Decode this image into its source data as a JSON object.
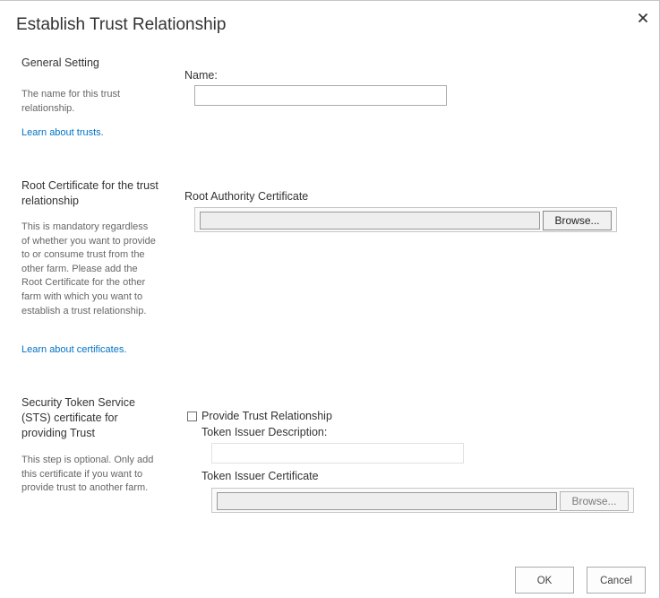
{
  "dialog": {
    "title": "Establish Trust Relationship",
    "close_icon": "close-icon"
  },
  "general": {
    "title": "General Setting",
    "description": "The name for this trust relationship.",
    "link": "Learn about trusts.",
    "name_label": "Name:",
    "name_value": ""
  },
  "root_cert": {
    "title": "Root Certificate for the trust relationship",
    "description": "This is mandatory regardless of whether you want to provide to or consume trust from the other farm. Please add the Root Certificate for the other farm with which you want to establish a trust relationship.",
    "link": "Learn about certificates.",
    "field_label": "Root Authority Certificate",
    "file_value": "",
    "browse_label": "Browse..."
  },
  "sts": {
    "title": "Security Token Service (STS) certificate for providing Trust",
    "description": "This step is optional. Only add this certificate if you want to provide trust to another farm.",
    "checkbox_label": "Provide Trust Relationship",
    "checkbox_checked": false,
    "token_desc_label": "Token Issuer Description:",
    "token_desc_value": "",
    "token_cert_label": "Token Issuer Certificate",
    "token_cert_value": "",
    "browse_label": "Browse..."
  },
  "footer": {
    "ok_label": "OK",
    "cancel_label": "Cancel"
  },
  "colors": {
    "link": "#0072c6",
    "text": "#444444",
    "muted": "#666666"
  }
}
